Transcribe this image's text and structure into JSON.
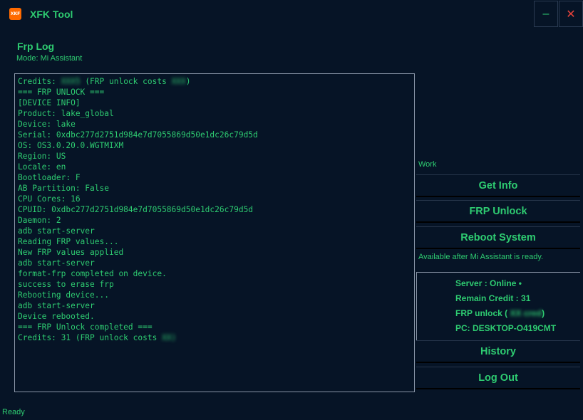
{
  "app": {
    "logo_text": "XKF",
    "title": "XFK Tool",
    "minimize": "–",
    "close": "✕"
  },
  "log": {
    "title": "Frp Log",
    "mode": "Mode: Mi Assistant",
    "lines": [
      {
        "parts": [
          {
            "t": "Credits: "
          },
          {
            "t": "XXX5",
            "blur": true
          },
          {
            "t": " (FRP unlock costs "
          },
          {
            "t": "XXX",
            "blur": true
          },
          {
            "t": ")"
          }
        ]
      },
      {
        "parts": [
          {
            "t": "=== FRP UNLOCK ==="
          }
        ]
      },
      {
        "parts": [
          {
            "t": "[DEVICE INFO]"
          }
        ]
      },
      {
        "parts": [
          {
            "t": "Product: lake_global"
          }
        ]
      },
      {
        "parts": [
          {
            "t": "Device: lake"
          }
        ]
      },
      {
        "parts": [
          {
            "t": "Serial: 0xdbc277d2751d984e7d7055869d50e1dc26c79d5d"
          }
        ]
      },
      {
        "parts": [
          {
            "t": "OS: OS3.0.20.0.WGTMIXM"
          }
        ]
      },
      {
        "parts": [
          {
            "t": "Region: US"
          }
        ]
      },
      {
        "parts": [
          {
            "t": "Locale: en"
          }
        ]
      },
      {
        "parts": [
          {
            "t": "Bootloader: F"
          }
        ]
      },
      {
        "parts": [
          {
            "t": "AB Partition: False"
          }
        ]
      },
      {
        "parts": [
          {
            "t": "CPU Cores: 16"
          }
        ]
      },
      {
        "parts": [
          {
            "t": "CPUID: 0xdbc277d2751d984e7d7055869d50e1dc26c79d5d"
          }
        ]
      },
      {
        "parts": [
          {
            "t": "Daemon: 2"
          }
        ]
      },
      {
        "parts": [
          {
            "t": "adb start-server"
          }
        ]
      },
      {
        "parts": [
          {
            "t": "Reading FRP values..."
          }
        ]
      },
      {
        "parts": [
          {
            "t": "New FRP values applied"
          }
        ]
      },
      {
        "parts": [
          {
            "t": "adb start-server"
          }
        ]
      },
      {
        "parts": [
          {
            "t": "format-frp completed on device."
          }
        ]
      },
      {
        "parts": [
          {
            "t": "success to erase frp"
          }
        ]
      },
      {
        "parts": [
          {
            "t": "Rebooting device..."
          }
        ]
      },
      {
        "parts": [
          {
            "t": "adb start-server"
          }
        ]
      },
      {
        "parts": [
          {
            "t": "Device rebooted."
          }
        ]
      },
      {
        "parts": [
          {
            "t": "=== FRP Unlock completed ==="
          }
        ]
      },
      {
        "parts": [
          {
            "t": "Credits: 31 (FRP unlock costs "
          },
          {
            "t": "XX)",
            "blur": true
          }
        ]
      }
    ]
  },
  "work": {
    "label": "Work",
    "get_info": "Get Info",
    "frp_unlock": "FRP Unlock",
    "reboot_system": "Reboot System",
    "note": "Available after Mi Assistant is ready."
  },
  "status": {
    "server": "Server : Online •",
    "remain_credit": "Remain Credit : 31",
    "frp_unlock_prefix": "FRP unlock ( ",
    "frp_unlock_cost": "XX cred",
    "frp_unlock_suffix": ")",
    "pc": "PC: DESKTOP-O419CMT"
  },
  "actions": {
    "history": "History",
    "log_out": "Log Out"
  },
  "status_bar": "Ready",
  "colors": {
    "background": "#061426",
    "accent": "#2ecc71",
    "close": "#e8433a",
    "logo": "#ff6a00"
  }
}
